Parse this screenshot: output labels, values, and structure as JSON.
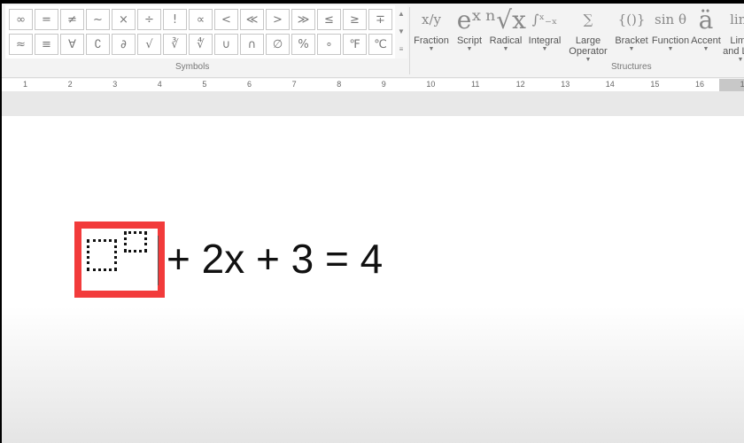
{
  "symbols": {
    "row1": [
      "∞",
      "=",
      "≠",
      "~",
      "×",
      "÷",
      "!",
      "∝",
      "<",
      "≪",
      ">",
      "≫",
      "≤",
      "≥",
      "∓"
    ],
    "row2": [
      "≈",
      "≡",
      "∀",
      "∁",
      "∂",
      "√",
      "∛",
      "∜",
      "∪",
      "∩",
      "∅",
      "%",
      "∘",
      "℉",
      "℃"
    ],
    "group_label": "Symbols"
  },
  "structures": {
    "items": [
      {
        "glyph": "x/y",
        "label": "Fraction",
        "icon": "fraction-icon"
      },
      {
        "glyph": "eˣ",
        "label": "Script",
        "icon": "script-icon"
      },
      {
        "glyph": "ⁿ√x",
        "label": "Radical",
        "icon": "radical-icon"
      },
      {
        "glyph": "∫ˣ₋ₓ",
        "label": "Integral",
        "icon": "integral-icon"
      },
      {
        "glyph": "∑",
        "label": "Large Operator",
        "icon": "large-operator-icon"
      },
      {
        "glyph": "{()}",
        "label": "Bracket",
        "icon": "bracket-icon"
      },
      {
        "glyph": "sin θ",
        "label": "Function",
        "icon": "function-icon"
      },
      {
        "glyph": "ä",
        "label": "Accent",
        "icon": "accent-icon"
      },
      {
        "glyph": "lim",
        "label": "Limit and Log",
        "icon": "limit-icon"
      }
    ],
    "group_label": "Structures"
  },
  "ruler": [
    "1",
    "2",
    "3",
    "4",
    "5",
    "6",
    "7",
    "8",
    "9",
    "10",
    "11",
    "12",
    "13",
    "14",
    "15",
    "16",
    "1"
  ],
  "equation": {
    "text": "+ 2x + 3 = 4",
    "highlight_color": "#f23b3b"
  }
}
